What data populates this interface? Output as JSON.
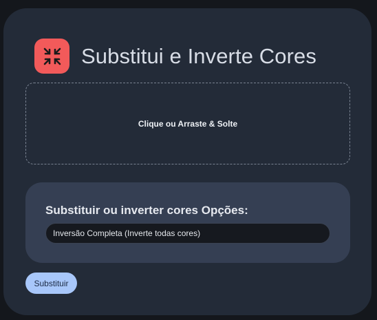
{
  "header": {
    "icon": "collapse-arrows-icon",
    "title": "Substitui e Inverte Cores",
    "accent_color": "#f25a5a"
  },
  "dropzone": {
    "label": "Clique ou Arraste & Solte"
  },
  "options": {
    "heading": "Substituir ou inverter cores Opções:",
    "selected_value": "Inversão Completa (Inverte todas cores)"
  },
  "actions": {
    "submit_label": "Substituir",
    "button_color": "#a8c7fa"
  }
}
